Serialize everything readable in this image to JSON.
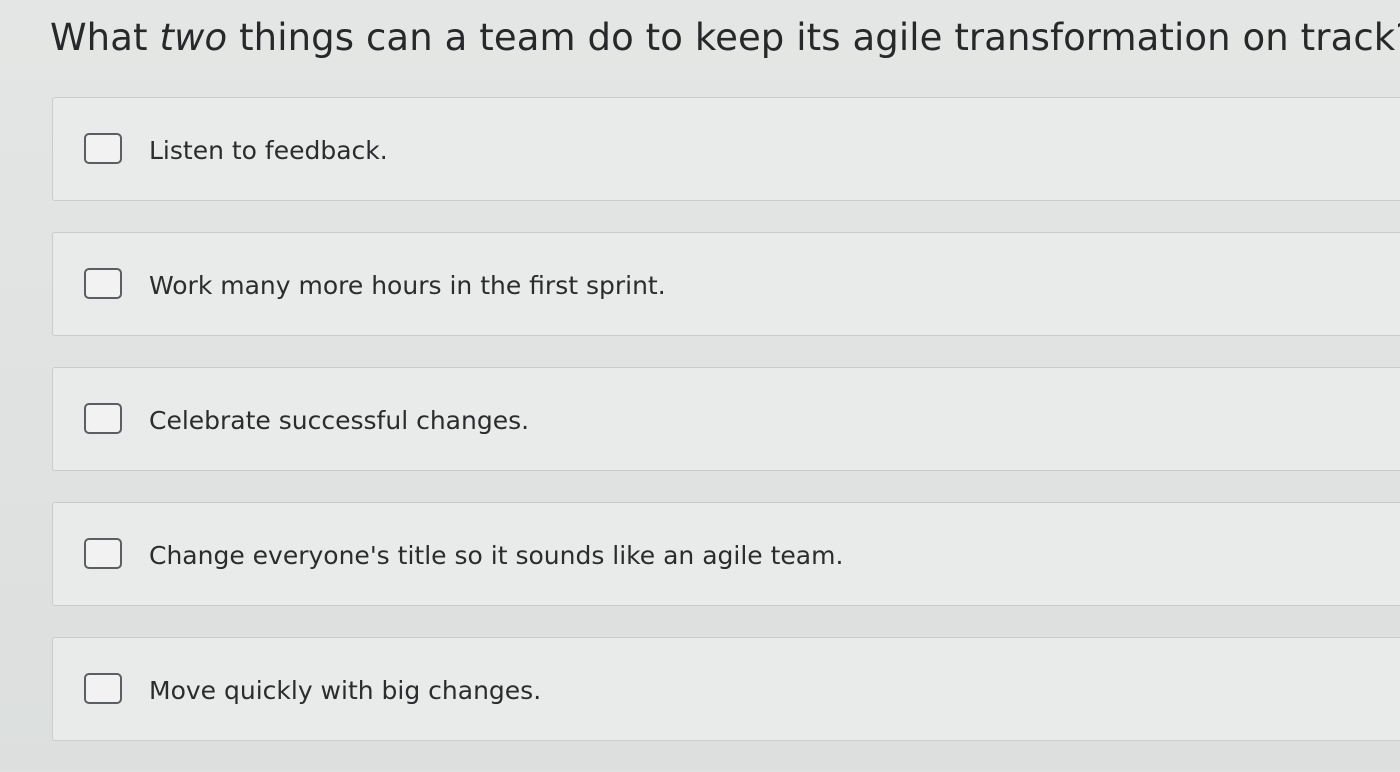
{
  "question": {
    "prefix": "What ",
    "emphasis": "two",
    "suffix": " things can a team do to keep its agile transformation on track?"
  },
  "options": [
    {
      "label": "Listen to feedback.",
      "checked": false
    },
    {
      "label": "Work many more hours in the first sprint.",
      "checked": false
    },
    {
      "label": "Celebrate successful changes.",
      "checked": false
    },
    {
      "label": "Change everyone's title so it sounds like an agile team.",
      "checked": false
    },
    {
      "label": "Move quickly with big changes.",
      "checked": false
    }
  ],
  "colors": {
    "background": "#dfe2e1",
    "option_background": "#e9ebea",
    "option_border": "#c9cccb",
    "checkbox_border": "#5b5f62",
    "text": "#2a2c2e"
  }
}
